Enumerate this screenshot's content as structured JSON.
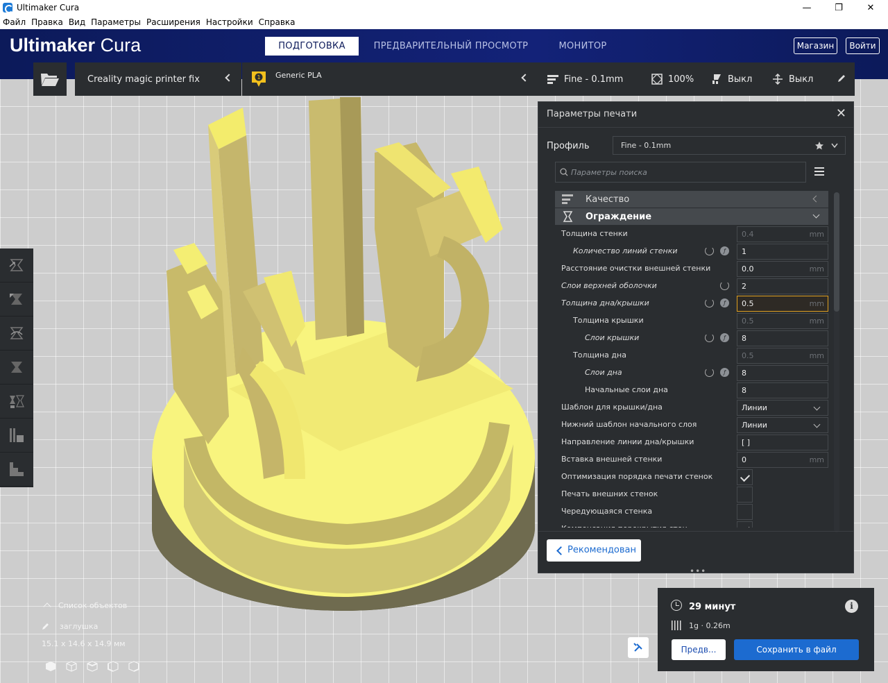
{
  "window": {
    "title": "Ultimaker Cura",
    "minimize": "—",
    "maximize": "❐",
    "close": "✕"
  },
  "menu": [
    "Файл",
    "Правка",
    "Вид",
    "Параметры",
    "Расширения",
    "Настройки",
    "Справка"
  ],
  "header": {
    "logo_bold": "Ultimaker",
    "logo_light": "Cura",
    "stages": [
      "ПОДГОТОВКА",
      "ПРЕДВАРИТЕЛЬНЫЙ ПРОСМОТР",
      "МОНИТОР"
    ],
    "active_stage": "ПОДГОТОВКА",
    "marketplace": "Магазин",
    "signin": "Войти"
  },
  "toolbar": {
    "printer": "Creality magic printer fix",
    "extruder_number": "1",
    "material": "Generic PLA",
    "quality": "Fine - 0.1mm",
    "infill": "100%",
    "support": "Выкл",
    "adhesion": "Выкл"
  },
  "settings_panel": {
    "title": "Параметры печати",
    "close": "✕",
    "profile_label": "Профиль",
    "profile_value": "Fine - 0.1mm",
    "search_placeholder": "Параметры поиска",
    "categories": [
      {
        "label": "Качество",
        "icon": "quality-icon",
        "expanded": false
      },
      {
        "label": "Ограждение",
        "icon": "shell-icon",
        "expanded": true
      }
    ],
    "rows": [
      {
        "label": "Толщина стенки",
        "indent": 0,
        "italic": false,
        "type": "field",
        "value": "0.4",
        "unit": "mm",
        "disabled": true,
        "reset": false,
        "info": false
      },
      {
        "label": "Количество линий стенки",
        "indent": 1,
        "italic": true,
        "type": "field",
        "value": "1",
        "unit": "",
        "disabled": false,
        "reset": true,
        "info": true
      },
      {
        "label": "Расстояние очистки внешней стенки",
        "indent": 0,
        "italic": false,
        "type": "field",
        "value": "0.0",
        "unit": "mm",
        "disabled": false,
        "reset": false,
        "info": false
      },
      {
        "label": "Слои верхней оболочки",
        "indent": 0,
        "italic": true,
        "type": "field",
        "value": "2",
        "unit": "",
        "disabled": false,
        "reset": true,
        "info": false,
        "reset_alt": true
      },
      {
        "label": "Толщина дна/крышки",
        "indent": 0,
        "italic": true,
        "type": "field",
        "value": "0.5",
        "unit": "mm",
        "disabled": false,
        "warn": true,
        "reset": true,
        "info": true
      },
      {
        "label": "Толщина крышки",
        "indent": 1,
        "italic": false,
        "type": "field",
        "value": "0.5",
        "unit": "mm",
        "disabled": true,
        "reset": false,
        "info": false
      },
      {
        "label": "Слои крышки",
        "indent": 2,
        "italic": true,
        "type": "field",
        "value": "8",
        "unit": "",
        "disabled": false,
        "reset": true,
        "info": true
      },
      {
        "label": "Толщина дна",
        "indent": 1,
        "italic": false,
        "type": "field",
        "value": "0.5",
        "unit": "mm",
        "disabled": true,
        "reset": false,
        "info": false
      },
      {
        "label": "Слои дна",
        "indent": 2,
        "italic": true,
        "type": "field",
        "value": "8",
        "unit": "",
        "disabled": false,
        "reset": true,
        "info": true
      },
      {
        "label": "Начальные слои дна",
        "indent": 2,
        "italic": false,
        "type": "field",
        "value": "8",
        "unit": "",
        "disabled": false,
        "reset": false,
        "info": false
      },
      {
        "label": "Шаблон для крышки/дна",
        "indent": 0,
        "italic": false,
        "type": "select",
        "value": "Линии",
        "unit": "",
        "disabled": false,
        "reset": false,
        "info": false
      },
      {
        "label": "Нижний шаблон начального слоя",
        "indent": 0,
        "italic": false,
        "type": "select",
        "value": "Линии",
        "unit": "",
        "disabled": false,
        "reset": false,
        "info": false
      },
      {
        "label": "Направление линии дна/крышки",
        "indent": 0,
        "italic": false,
        "type": "field",
        "value": "[ ]",
        "unit": "",
        "disabled": false,
        "reset": false,
        "info": false
      },
      {
        "label": "Вставка внешней стенки",
        "indent": 0,
        "italic": false,
        "type": "field",
        "value": "0",
        "unit": "mm",
        "disabled": false,
        "reset": false,
        "info": false
      },
      {
        "label": "Оптимизация порядка печати стенок",
        "indent": 0,
        "italic": false,
        "type": "check",
        "checked": true,
        "reset": false,
        "info": false
      },
      {
        "label": "Печать внешних стенок",
        "indent": 0,
        "italic": false,
        "type": "check",
        "checked": false,
        "reset": false,
        "info": false
      },
      {
        "label": "Чередующаяся стенка",
        "indent": 0,
        "italic": false,
        "type": "check",
        "checked": false,
        "reset": false,
        "info": false
      },
      {
        "label": "Компенсация перекрытия стен",
        "indent": 0,
        "italic": false,
        "type": "check",
        "checked": true,
        "reset": false,
        "info": false,
        "clipped": true
      }
    ],
    "recommended_button": "Рекомендован",
    "drag_handle": "•••"
  },
  "summary": {
    "time": "29 минут",
    "material_usage": "1g · 0.26m",
    "info": "i",
    "preview_button": "Предв...",
    "save_button": "Сохранить в файл"
  },
  "object_list": {
    "title": "Список объектов",
    "object_name": "заглушка",
    "dimensions": "15.1 x 14.6 x 14.9 мм"
  },
  "colors": {
    "header": "#0c1a5a",
    "panel": "#2a2d30",
    "accent": "#1c6bd0",
    "model": "#f5f070",
    "warn": "#e0a020"
  }
}
